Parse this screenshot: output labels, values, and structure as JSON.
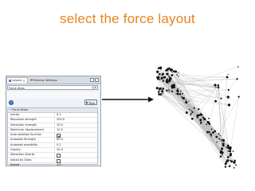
{
  "slide": {
    "title": "select the force layout"
  },
  "panel": {
    "tabs": [
      {
        "label": "Layout",
        "active": true
      },
      {
        "label": "Preview Settings",
        "active": false
      }
    ],
    "layout_select": {
      "value": "Force Atlas"
    },
    "run_button": {
      "label": "Run"
    },
    "section_title": "Force Atlas",
    "properties": [
      {
        "name": "Inertia",
        "value": "0.1"
      },
      {
        "name": "Repulsion strength",
        "value": "200.0"
      },
      {
        "name": "Attraction strength",
        "value": "10.0"
      },
      {
        "name": "Maximum displacement",
        "value": "10.0"
      },
      {
        "name": "Auto stabilize function",
        "checked": true
      },
      {
        "name": "Autostab Strength",
        "value": "80.0"
      },
      {
        "name": "Autostab sensibility",
        "value": "0.2"
      },
      {
        "name": "Gravity",
        "value": "30.0"
      },
      {
        "name": "Attraction Distrib.",
        "checked": false
      },
      {
        "name": "Adjust by Sizes",
        "checked": false
      },
      {
        "name": "Speed",
        "value": "1.0"
      }
    ]
  },
  "icons": {
    "info": "info-icon",
    "play": "play-icon",
    "arrow": "arrow-right-icon"
  },
  "colors": {
    "title": "#e8841f",
    "info": "#2a62b0",
    "graph_nodes": "#111111",
    "graph_edges": "#b5b5b5"
  }
}
